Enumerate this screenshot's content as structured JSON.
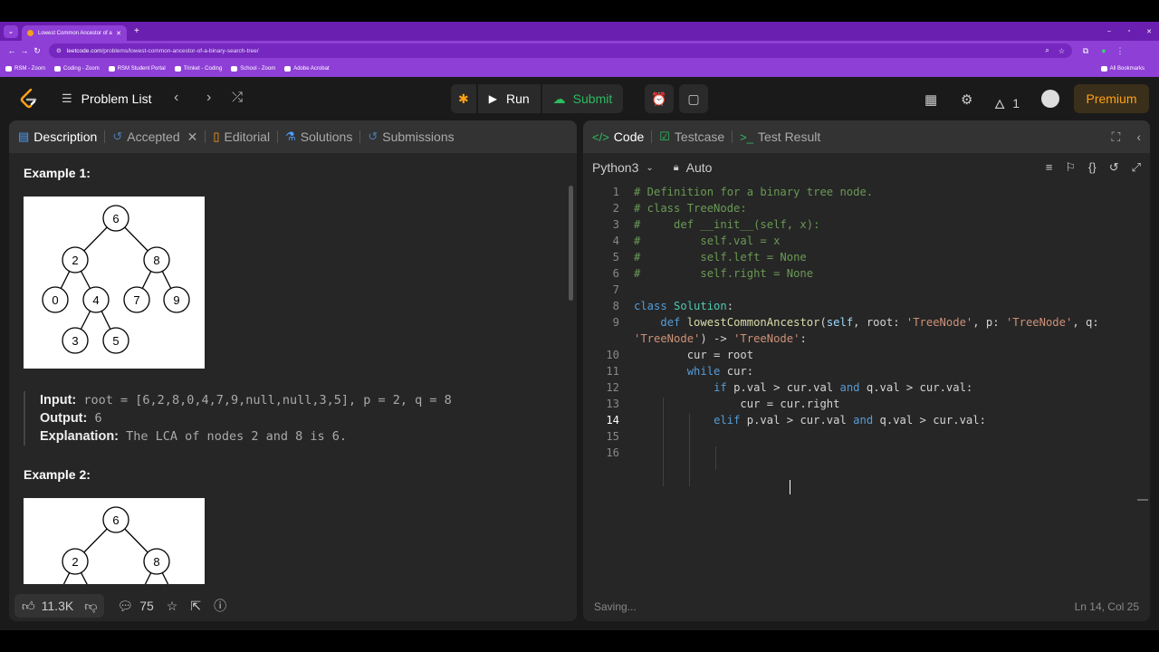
{
  "browser": {
    "tab_title": "Lowest Common Ancestor of a",
    "new_tab": "+",
    "url_host": "leetcode.com",
    "url_path": "/problems/lowest-common-ancestor-of-a-binary-search-tree/",
    "bookmarks": [
      "RSM - Zoom",
      "Coding - Zoom",
      "RSM Student Portal",
      "Trinket - Coding",
      "School - Zoom",
      "Adobe Acrobat"
    ],
    "all_bookmarks": "All Bookmarks"
  },
  "nav": {
    "problem_list": "Problem List",
    "run": "Run",
    "submit": "Submit",
    "streak": "1",
    "premium": "Premium"
  },
  "left": {
    "tabs": {
      "description": "Description",
      "accepted": "Accepted",
      "editorial": "Editorial",
      "solutions": "Solutions",
      "submissions": "Submissions"
    },
    "example1": {
      "title": "Example 1:",
      "input_label": "Input:",
      "input": "root = [6,2,8,0,4,7,9,null,null,3,5], p = 2, q = 8",
      "output_label": "Output:",
      "output": "6",
      "explanation_label": "Explanation:",
      "explanation": "The LCA of nodes 2 and 8 is 6."
    },
    "example2": {
      "title": "Example 2:"
    },
    "tree": {
      "root": "6",
      "l": "2",
      "r": "8",
      "ll": "0",
      "lr": "4",
      "rl": "7",
      "rr": "9",
      "lrl": "3",
      "lrr": "5"
    },
    "footer": {
      "likes": "11.3K",
      "comments": "75"
    }
  },
  "right": {
    "tabs": {
      "code": "Code",
      "testcase": "Testcase",
      "result": "Test Result"
    },
    "language": "Python3",
    "auto": "Auto",
    "status": "Saving...",
    "cursor": "Ln 14, Col 25",
    "code_lines": [
      "# Definition for a binary tree node.",
      "# class TreeNode:",
      "#     def __init__(self, x):",
      "#         self.val = x",
      "#         self.left = None",
      "#         self.right = None",
      "",
      "class Solution:",
      "    def lowestCommonAncestor(self, root: 'TreeNode', p: 'TreeNode', q:",
      "'TreeNode') -> 'TreeNode':",
      "        cur = root",
      "        while cur:",
      "            if p.val > cur.val and q.val > cur.val:",
      "                cur = cur.right",
      "            elif p.val > cur.val and q.val > cur.val:",
      "",
      ""
    ],
    "line_numbers": [
      "1",
      "2",
      "3",
      "4",
      "5",
      "6",
      "7",
      "8",
      "9",
      "",
      "10",
      "11",
      "12",
      "13",
      "14",
      "15",
      "16"
    ]
  }
}
